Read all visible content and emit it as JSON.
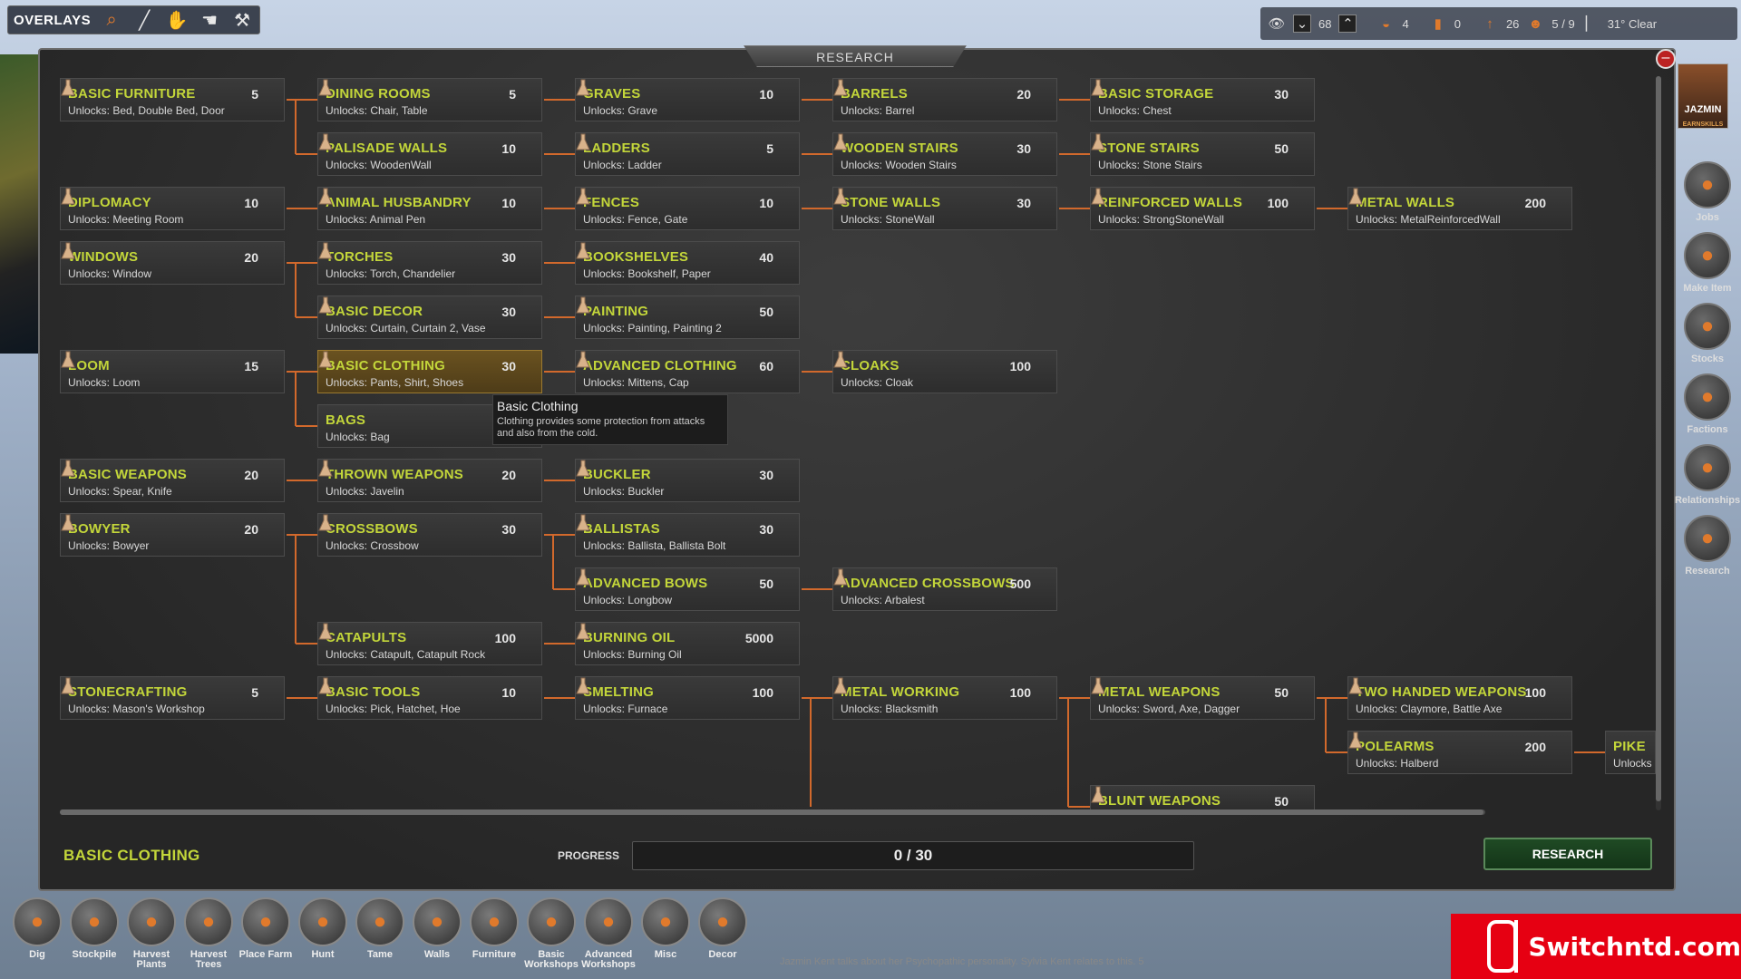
{
  "topbar": {
    "overlays_label": "OVERLAYS"
  },
  "status": {
    "v1": "68",
    "v2": "4",
    "v3": "0",
    "v4": "26",
    "v5": "5 / 9",
    "weather": "31° Clear"
  },
  "panel": {
    "title": "RESEARCH"
  },
  "research": [
    {
      "name": "BASIC FURNITURE",
      "unlocks": "Unlocks: Bed, Double Bed, Door",
      "cost": "5"
    },
    {
      "name": "DINING ROOMS",
      "unlocks": "Unlocks: Chair, Table",
      "cost": "5"
    },
    {
      "name": "GRAVES",
      "unlocks": "Unlocks: Grave",
      "cost": "10"
    },
    {
      "name": "BARRELS",
      "unlocks": "Unlocks: Barrel",
      "cost": "20"
    },
    {
      "name": "BASIC STORAGE",
      "unlocks": "Unlocks: Chest",
      "cost": "30"
    },
    {
      "name": "PALISADE WALLS",
      "unlocks": "Unlocks: WoodenWall",
      "cost": "10"
    },
    {
      "name": "LADDERS",
      "unlocks": "Unlocks: Ladder",
      "cost": "5"
    },
    {
      "name": "WOODEN STAIRS",
      "unlocks": "Unlocks: Wooden Stairs",
      "cost": "30"
    },
    {
      "name": "STONE STAIRS",
      "unlocks": "Unlocks: Stone Stairs",
      "cost": "50"
    },
    {
      "name": "DIPLOMACY",
      "unlocks": "Unlocks: Meeting Room",
      "cost": "10"
    },
    {
      "name": "ANIMAL HUSBANDRY",
      "unlocks": "Unlocks: Animal Pen",
      "cost": "10"
    },
    {
      "name": "FENCES",
      "unlocks": "Unlocks: Fence, Gate",
      "cost": "10"
    },
    {
      "name": "STONE WALLS",
      "unlocks": "Unlocks: StoneWall",
      "cost": "30"
    },
    {
      "name": "REINFORCED WALLS",
      "unlocks": "Unlocks: StrongStoneWall",
      "cost": "100"
    },
    {
      "name": "METAL WALLS",
      "unlocks": "Unlocks: MetalReinforcedWall",
      "cost": "200"
    },
    {
      "name": "WINDOWS",
      "unlocks": "Unlocks: Window",
      "cost": "20"
    },
    {
      "name": "TORCHES",
      "unlocks": "Unlocks: Torch, Chandelier",
      "cost": "30"
    },
    {
      "name": "BOOKSHELVES",
      "unlocks": "Unlocks: Bookshelf, Paper",
      "cost": "40"
    },
    {
      "name": "BASIC DECOR",
      "unlocks": "Unlocks: Curtain, Curtain 2, Vase",
      "cost": "30"
    },
    {
      "name": "PAINTING",
      "unlocks": "Unlocks: Painting, Painting 2",
      "cost": "50"
    },
    {
      "name": "LOOM",
      "unlocks": "Unlocks: Loom",
      "cost": "15"
    },
    {
      "name": "BASIC CLOTHING",
      "unlocks": "Unlocks: Pants, Shirt, Shoes",
      "cost": "30"
    },
    {
      "name": "ADVANCED CLOTHING",
      "unlocks": "Unlocks: Mittens, Cap",
      "cost": "60"
    },
    {
      "name": "CLOAKS",
      "unlocks": "Unlocks: Cloak",
      "cost": "100"
    },
    {
      "name": "BAGS",
      "unlocks": "Unlocks: Bag",
      "cost": ""
    },
    {
      "name": "BASIC WEAPONS",
      "unlocks": "Unlocks: Spear, Knife",
      "cost": "20"
    },
    {
      "name": "THROWN WEAPONS",
      "unlocks": "Unlocks: Javelin",
      "cost": "20"
    },
    {
      "name": "BUCKLER",
      "unlocks": "Unlocks: Buckler",
      "cost": "30"
    },
    {
      "name": "BOWYER",
      "unlocks": "Unlocks: Bowyer",
      "cost": "20"
    },
    {
      "name": "CROSSBOWS",
      "unlocks": "Unlocks: Crossbow",
      "cost": "30"
    },
    {
      "name": "BALLISTAS",
      "unlocks": "Unlocks: Ballista, Ballista Bolt",
      "cost": "30"
    },
    {
      "name": "ADVANCED BOWS",
      "unlocks": "Unlocks: Longbow",
      "cost": "50"
    },
    {
      "name": "ADVANCED CROSSBOWS",
      "unlocks": "Unlocks: Arbalest",
      "cost": "500"
    },
    {
      "name": "CATAPULTS",
      "unlocks": "Unlocks: Catapult, Catapult Rock",
      "cost": "100"
    },
    {
      "name": "BURNING OIL",
      "unlocks": "Unlocks: Burning Oil",
      "cost": "5000"
    },
    {
      "name": "STONECRAFTING",
      "unlocks": "Unlocks: Mason's Workshop",
      "cost": "5"
    },
    {
      "name": "BASIC TOOLS",
      "unlocks": "Unlocks: Pick, Hatchet, Hoe",
      "cost": "10"
    },
    {
      "name": "SMELTING",
      "unlocks": "Unlocks: Furnace",
      "cost": "100"
    },
    {
      "name": "METAL WORKING",
      "unlocks": "Unlocks: Blacksmith",
      "cost": "100"
    },
    {
      "name": "METAL WEAPONS",
      "unlocks": "Unlocks: Sword, Axe, Dagger",
      "cost": "50"
    },
    {
      "name": "TWO HANDED WEAPONS",
      "unlocks": "Unlocks: Claymore, Battle Axe",
      "cost": "100"
    },
    {
      "name": "POLEARMS",
      "unlocks": "Unlocks: Halberd",
      "cost": "200"
    },
    {
      "name": "PIKE",
      "unlocks": "Unlocks",
      "cost": ""
    },
    {
      "name": "BLUNT WEAPONS",
      "unlocks": "",
      "cost": "50"
    }
  ],
  "tooltip": {
    "title": "Basic Clothing",
    "desc": "Clothing provides some protection from attacks and also from the cold."
  },
  "footer": {
    "selected_name": "BASIC CLOTHING",
    "progress_label": "PROGRESS",
    "progress_text": "0 / 30",
    "progress_fraction": 0,
    "research_button": "RESEARCH"
  },
  "avatar": {
    "name": "JAZMIN",
    "skills": "EARNSKILLS"
  },
  "sidebar": [
    {
      "label": "Jobs",
      "icon": "pickaxe-icon"
    },
    {
      "label": "Make Item",
      "icon": "tools-icon"
    },
    {
      "label": "Stocks",
      "icon": "crates-icon"
    },
    {
      "label": "Factions",
      "icon": "target-icon"
    },
    {
      "label": "Relationships",
      "icon": "speech-bubble-icon"
    },
    {
      "label": "Research",
      "icon": "flask-icon"
    }
  ],
  "bottombar": [
    {
      "label": "Dig",
      "icon": "shovel-icon"
    },
    {
      "label": "Stockpile",
      "icon": "stockpile-icon"
    },
    {
      "label": "Harvest Plants",
      "icon": "plant-icon"
    },
    {
      "label": "Harvest Trees",
      "icon": "tree-icon"
    },
    {
      "label": "Place Farm",
      "icon": "pitchfork-icon"
    },
    {
      "label": "Hunt",
      "icon": "bow-icon"
    },
    {
      "label": "Tame",
      "icon": "lasso-icon"
    },
    {
      "label": "Walls",
      "icon": "bricks-icon"
    },
    {
      "label": "Furniture",
      "icon": "bed-icon"
    },
    {
      "label": "Basic Workshops",
      "icon": "hammer-icon"
    },
    {
      "label": "Advanced Workshops",
      "icon": "anvil-icon"
    },
    {
      "label": "Misc",
      "icon": "ladder-icon"
    },
    {
      "label": "Decor",
      "icon": "torch-icon"
    }
  ],
  "log": "Jazmin Kent talks about her Psychopathic personality. Sylvia Kent relates to this. 5",
  "brand": {
    "text": "Switchntd.com"
  },
  "colors": {
    "accent": "#c3d63a",
    "connector": "#d2692c",
    "selected": "#6a5220",
    "research_button": "#1f4a24"
  }
}
